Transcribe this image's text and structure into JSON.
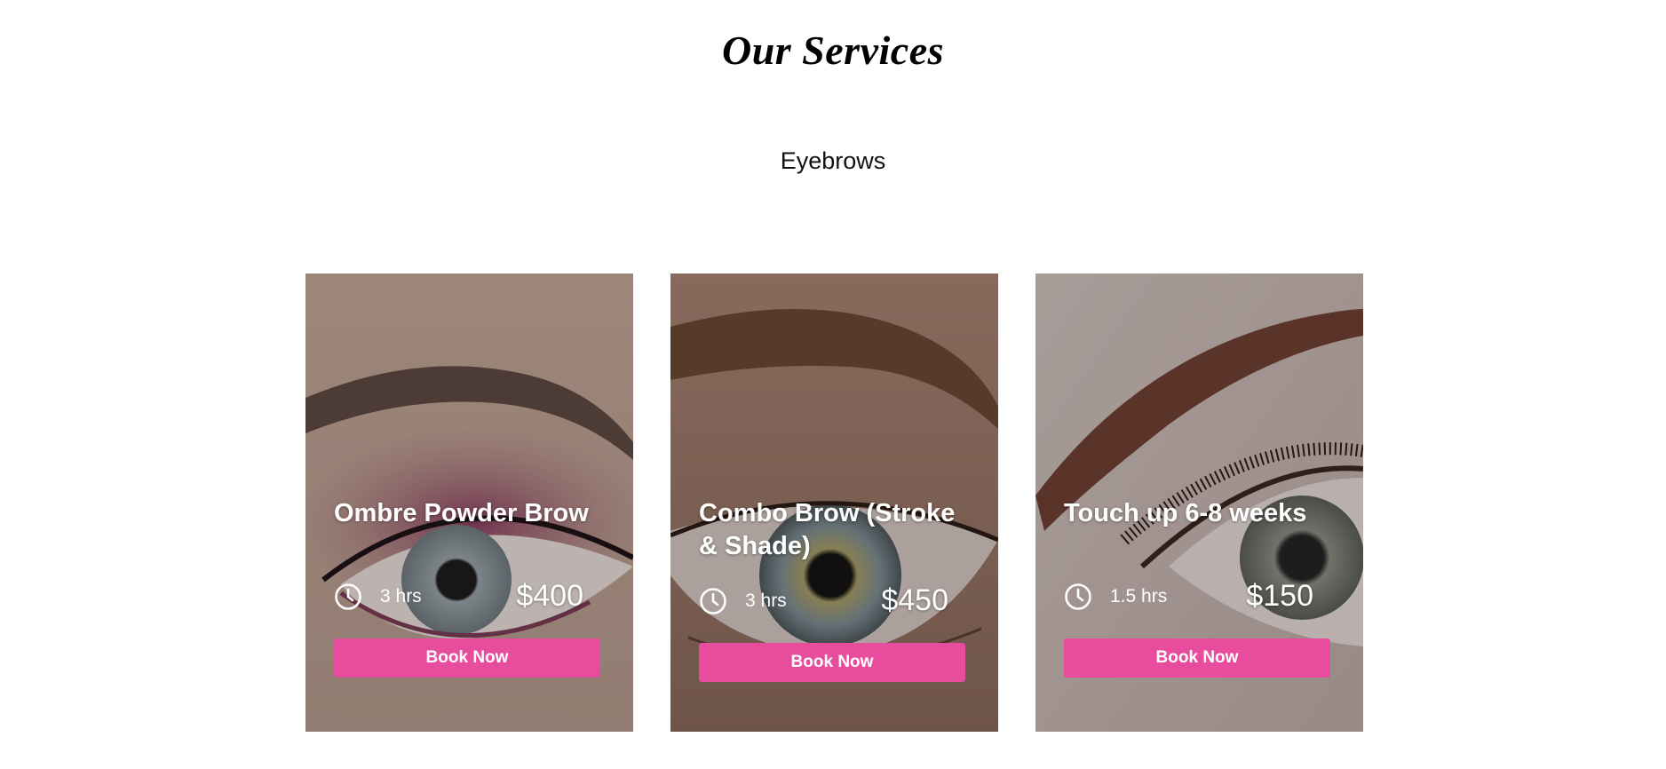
{
  "section": {
    "title": "Our Services",
    "category": "Eyebrows"
  },
  "colors": {
    "accent": "#e84c9d",
    "text_on_image": "#ffffff"
  },
  "services": [
    {
      "title": "Ombre Powder Brow",
      "duration": "3 hrs",
      "price": "$400",
      "button_label": "Book Now",
      "icon": "clock-icon"
    },
    {
      "title": "Combo Brow (Stroke & Shade)",
      "duration": "3 hrs",
      "price": "$450",
      "button_label": "Book Now",
      "icon": "clock-icon"
    },
    {
      "title": "Touch up 6-8 weeks",
      "duration": "1.5 hrs",
      "price": "$150",
      "button_label": "Book Now",
      "icon": "clock-icon"
    }
  ]
}
